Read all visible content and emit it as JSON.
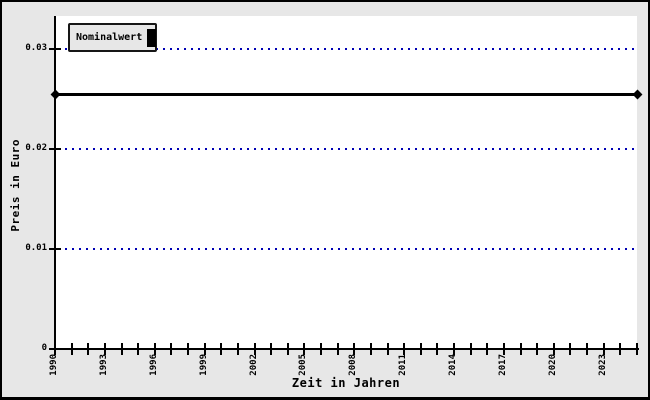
{
  "colors": {
    "canvas_bg": "#e7e7e7",
    "plot_bg": "#ffffff",
    "axis": "#000000",
    "grid": "#0000b4",
    "series": "#000000",
    "legend_border": "#161616"
  },
  "legend": {
    "label": "Nominalwert",
    "marker": "black-bar"
  },
  "chart_data": {
    "type": "line",
    "title": "",
    "xlabel": "Zeit in Jahren",
    "ylabel": "Preis in Euro",
    "legend_entries": [
      {
        "label": "Nominalwert",
        "marker": "black-bar"
      }
    ],
    "x_axis": {
      "min": 1990,
      "max": 2025,
      "tick_interval": 1,
      "label_interval": 3,
      "tick_labels": [
        "1990",
        "1993",
        "1996",
        "1999",
        "2002",
        "2005",
        "2008",
        "2011",
        "2014",
        "2017",
        "2020",
        "2023"
      ]
    },
    "y_axis": {
      "min": 0,
      "max": 0.0333,
      "tick_values": [
        0,
        0.01,
        0.02,
        0.03
      ],
      "tick_labels": [
        "0",
        "0.01",
        "0.02",
        "0.03"
      ]
    },
    "grid": {
      "on": true,
      "values": [
        0.01,
        0.02,
        0.03
      ],
      "style": "dotted",
      "color": "#0000b4"
    },
    "series": [
      {
        "name": "Nominalwert",
        "shape": "constant-horizontal-line",
        "value": 0.0255,
        "x_start": 1990,
        "x_end": 2025,
        "color": "#000000",
        "marker": "diamond",
        "marker_positions": "line-ends"
      }
    ],
    "legend_position": "top-left-inside"
  }
}
